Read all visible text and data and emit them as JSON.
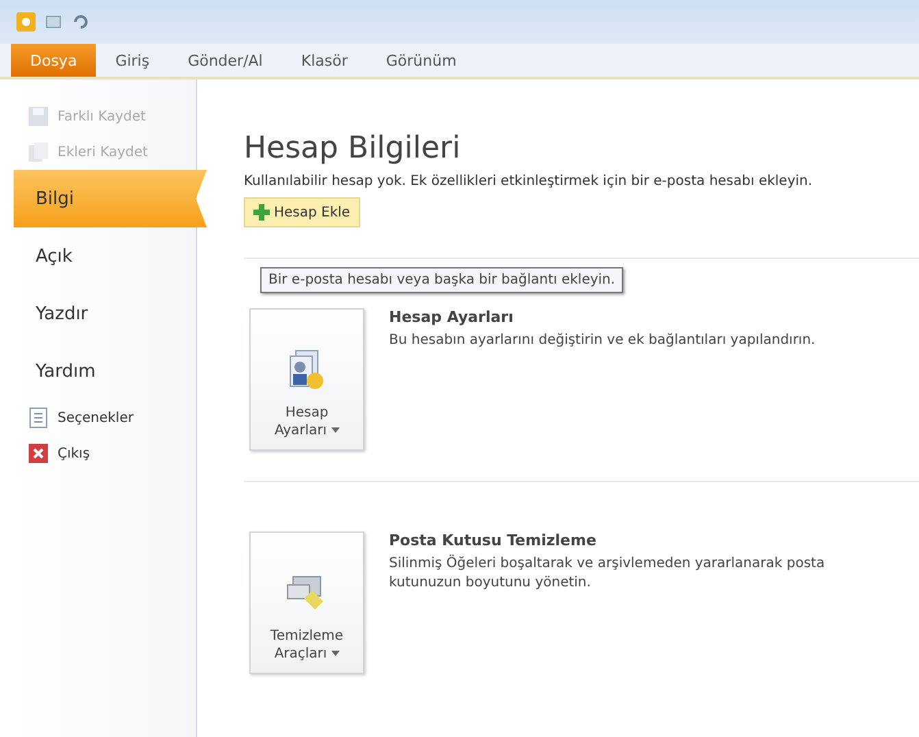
{
  "ribbon_tabs": [
    {
      "label": "Dosya",
      "selected": true
    },
    {
      "label": "Giriş",
      "selected": false
    },
    {
      "label": "Gönder/Al",
      "selected": false
    },
    {
      "label": "Klasör",
      "selected": false
    },
    {
      "label": "Görünüm",
      "selected": false
    }
  ],
  "sidebar": {
    "items": [
      {
        "kind": "command",
        "label": "Farklı Kaydet",
        "disabled": true
      },
      {
        "kind": "command",
        "label": "Ekleri Kaydet",
        "disabled": true
      },
      {
        "kind": "tab",
        "label": "Bilgi",
        "selected": true
      },
      {
        "kind": "tab",
        "label": "Açık",
        "selected": false
      },
      {
        "kind": "tab",
        "label": "Yazdır",
        "selected": false
      },
      {
        "kind": "tab",
        "label": "Yardım",
        "selected": false
      },
      {
        "kind": "command",
        "label": "Seçenekler",
        "disabled": false
      },
      {
        "kind": "command",
        "label": "Çıkış",
        "disabled": false
      }
    ]
  },
  "content": {
    "title": "Hesap Bilgileri",
    "subtitle": "Kullanılabilir hesap yok. Ek özellikleri etkinleştirmek için bir e-posta hesabı ekleyin.",
    "add_button": "Hesap Ekle",
    "tooltip": "Bir e-posta hesabı veya başka bir bağlantı ekleyin.",
    "sections": [
      {
        "button": [
          "Hesap",
          "Ayarları"
        ],
        "heading": "Hesap Ayarları",
        "description": "Bu hesabın ayarlarını değiştirin ve ek bağlantıları yapılandırın."
      },
      {
        "button": [
          "Temizleme",
          "Araçları"
        ],
        "heading": "Posta Kutusu Temizleme",
        "description": "Silinmiş Öğeleri boşaltarak ve arşivlemeden yararlanarak posta kutunuzun boyutunu yönetin."
      }
    ]
  }
}
